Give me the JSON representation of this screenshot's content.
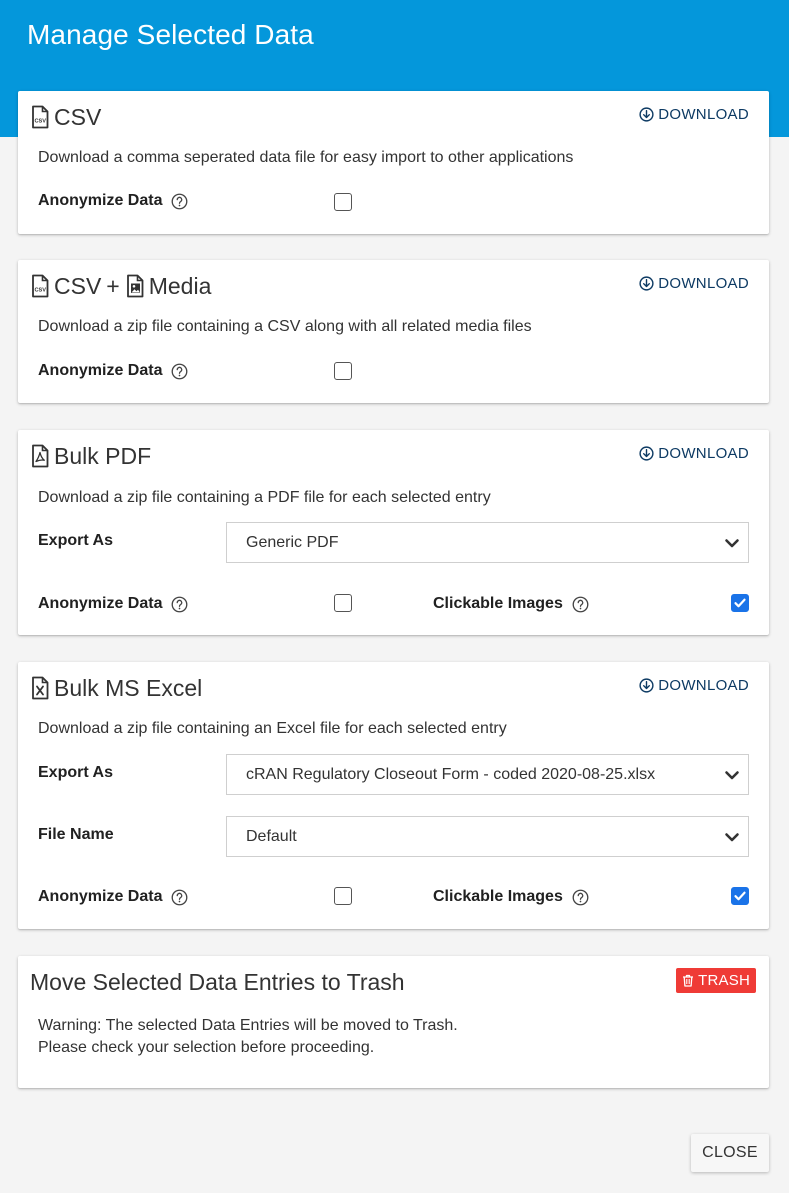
{
  "dialog": {
    "title": "Manage Selected Data",
    "close_label": "CLOSE",
    "header_color": "#0497db"
  },
  "common": {
    "download_label": "DOWNLOAD",
    "anonymize_label": "Anonymize Data",
    "clickable_images_label": "Clickable Images",
    "export_as_label": "Export As",
    "file_name_label": "File Name"
  },
  "csv": {
    "title": "CSV",
    "description": "Download a comma seperated data file for easy import to other applications",
    "anonymize_checked": false
  },
  "csv_media": {
    "title_part1": "CSV",
    "title_plus": "+",
    "title_part2": "Media",
    "description": "Download a zip file containing a CSV along with all related media files",
    "anonymize_checked": false
  },
  "bulk_pdf": {
    "title": "Bulk PDF",
    "description": "Download a zip file containing a PDF file for each selected entry",
    "export_as_value": "Generic PDF",
    "anonymize_checked": false,
    "clickable_images_checked": true
  },
  "bulk_excel": {
    "title": "Bulk MS Excel",
    "description": "Download a zip file containing an Excel file for each selected entry",
    "export_as_value": "cRAN Regulatory Closeout Form - coded 2020-08-25.xlsx",
    "file_name_value": "Default",
    "anonymize_checked": false,
    "clickable_images_checked": true
  },
  "trash": {
    "title": "Move Selected Data Entries to Trash",
    "button_label": "TRASH",
    "warning_line1": "Warning: The selected Data Entries will be moved to Trash.",
    "warning_line2": "Please check your selection before proceeding.",
    "button_color": "#ef3b36"
  },
  "icons": {
    "csv": "csv-file-icon",
    "media": "image-file-icon",
    "pdf": "pdf-file-icon",
    "excel": "excel-file-icon",
    "download": "download-circle-icon",
    "help": "help-circle-icon",
    "trash": "trash-icon",
    "chevron": "chevron-down-icon"
  }
}
